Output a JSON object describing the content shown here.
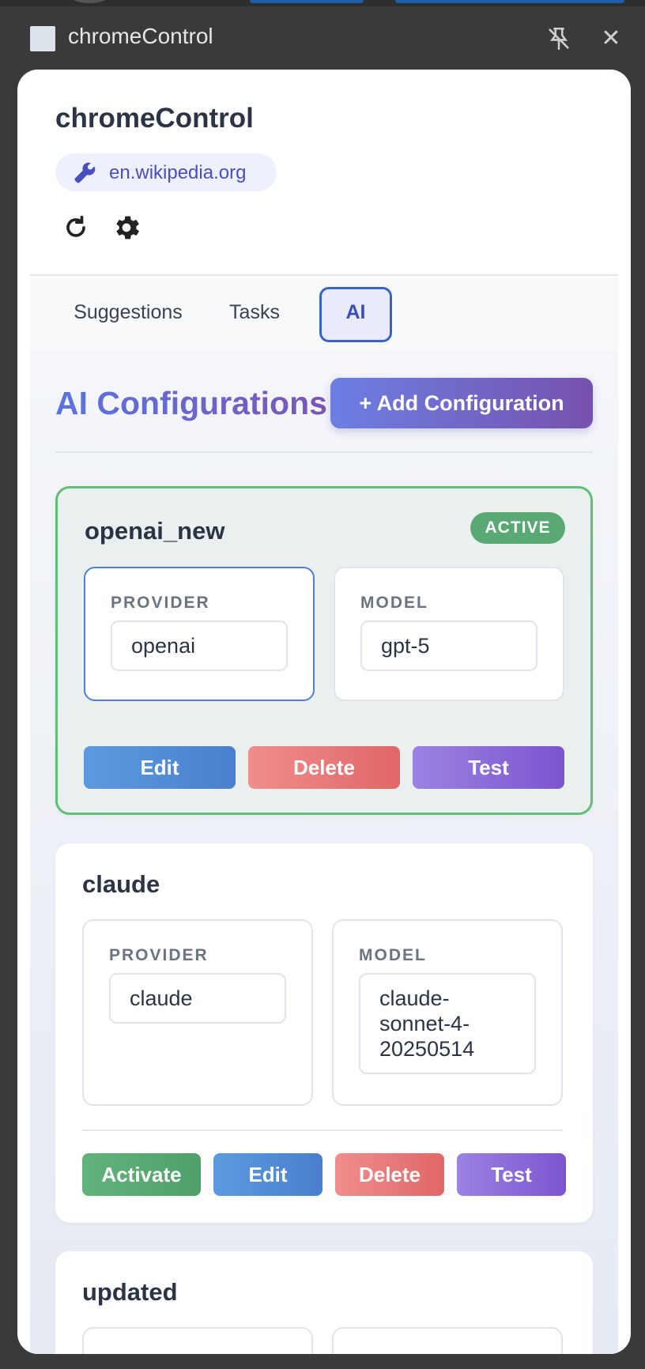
{
  "window": {
    "title": "chromeControl"
  },
  "header": {
    "title": "chromeControl",
    "domain": "en.wikipedia.org"
  },
  "tabs": [
    {
      "label": "Suggestions",
      "active": false
    },
    {
      "label": "Tasks",
      "active": false
    },
    {
      "label": "AI",
      "active": true
    }
  ],
  "section": {
    "title": "AI Configurations",
    "add_button": "+ Add Configuration"
  },
  "configs": [
    {
      "name": "openai_new",
      "badge": "ACTIVE",
      "provider_label": "PROVIDER",
      "provider": "openai",
      "model_label": "MODEL",
      "model": "gpt-5",
      "buttons": {
        "edit": "Edit",
        "delete": "Delete",
        "test": "Test"
      }
    },
    {
      "name": "claude",
      "provider_label": "PROVIDER",
      "provider": "claude",
      "model_label": "MODEL",
      "model": "claude-sonnet-4-20250514",
      "model_lines": [
        "claude-",
        "sonnet-4-",
        "20250514"
      ],
      "buttons": {
        "activate": "Activate",
        "edit": "Edit",
        "delete": "Delete",
        "test": "Test"
      }
    },
    {
      "name": "updated"
    }
  ],
  "colors": {
    "active_border": "#5fbf75",
    "accent": "#3a63c8",
    "edit": "#4a7fce",
    "delete": "#e06767",
    "test": "#7b55cf",
    "activate": "#4f9f68"
  }
}
